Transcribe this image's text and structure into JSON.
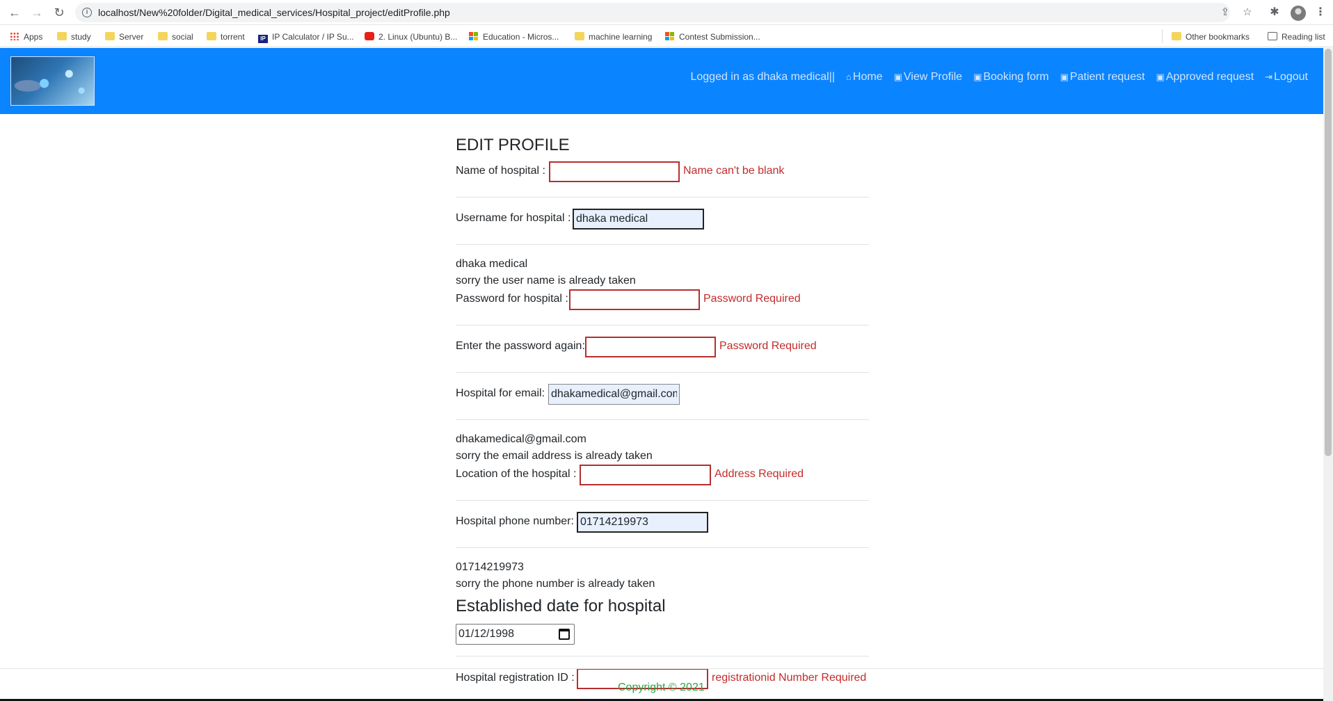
{
  "browser": {
    "url": "localhost/New%20folder/Digital_medical_services/Hospital_project/editProfile.php",
    "bookmarks": [
      {
        "label": "Apps",
        "icon": "apps-grid-icon"
      },
      {
        "label": "study",
        "icon": "folder-icon"
      },
      {
        "label": "Server",
        "icon": "folder-icon"
      },
      {
        "label": "social",
        "icon": "folder-icon"
      },
      {
        "label": "torrent",
        "icon": "folder-icon"
      },
      {
        "label": "IP Calculator / IP Su...",
        "icon": "ip-icon"
      },
      {
        "label": "2. Linux (Ubuntu) B...",
        "icon": "youtube-icon"
      },
      {
        "label": "Education - Micros...",
        "icon": "microsoft-icon"
      },
      {
        "label": "machine learning",
        "icon": "folder-icon"
      },
      {
        "label": "Contest Submission...",
        "icon": "microsoft-icon"
      }
    ],
    "other_bookmarks": "Other bookmarks",
    "reading_list": "Reading list",
    "ip_badge": "IP"
  },
  "nav": {
    "logged_in": "Logged in as dhaka medical||",
    "home": "Home",
    "view_profile": "View Profile",
    "booking_form": "Booking form",
    "patient_request": "Patient request",
    "approved_request": "Approved request",
    "logout": "Logout",
    "link_color": "#cfe5ff",
    "bar_color": "#0b84ff"
  },
  "form": {
    "title": "EDIT PROFILE",
    "name_label": "Name of hospital :",
    "name_value": "",
    "name_error": "Name can't be blank",
    "username_label": "Username for hospital :",
    "username_value": "dhaka medical",
    "username_echo": "dhaka medical",
    "username_taken": "sorry the user name is already taken",
    "password_label": "Password for hospital :",
    "password_error": "Password Required",
    "password2_label": "Enter the password again:",
    "password2_error": "Password Required",
    "email_label": "Hospital for email:",
    "email_value": "dhakamedical@gmail.com",
    "email_echo": "dhakamedical@gmail.com",
    "email_taken": "sorry the email address is already taken",
    "location_label": "Location of the hospital :",
    "location_error": "Address Required",
    "phone_label": "Hospital phone number:",
    "phone_value": "01714219973",
    "phone_echo": "01714219973",
    "phone_taken": "sorry the phone number is already taken",
    "established_heading": "Established date for hospital",
    "established_value": "01/12/1998",
    "regid_label": "Hospital registration ID :",
    "regid_error": "registrationid Number Required",
    "error_color": "#c22b2b"
  },
  "footer": {
    "copyright": "Copyright © 2021"
  }
}
